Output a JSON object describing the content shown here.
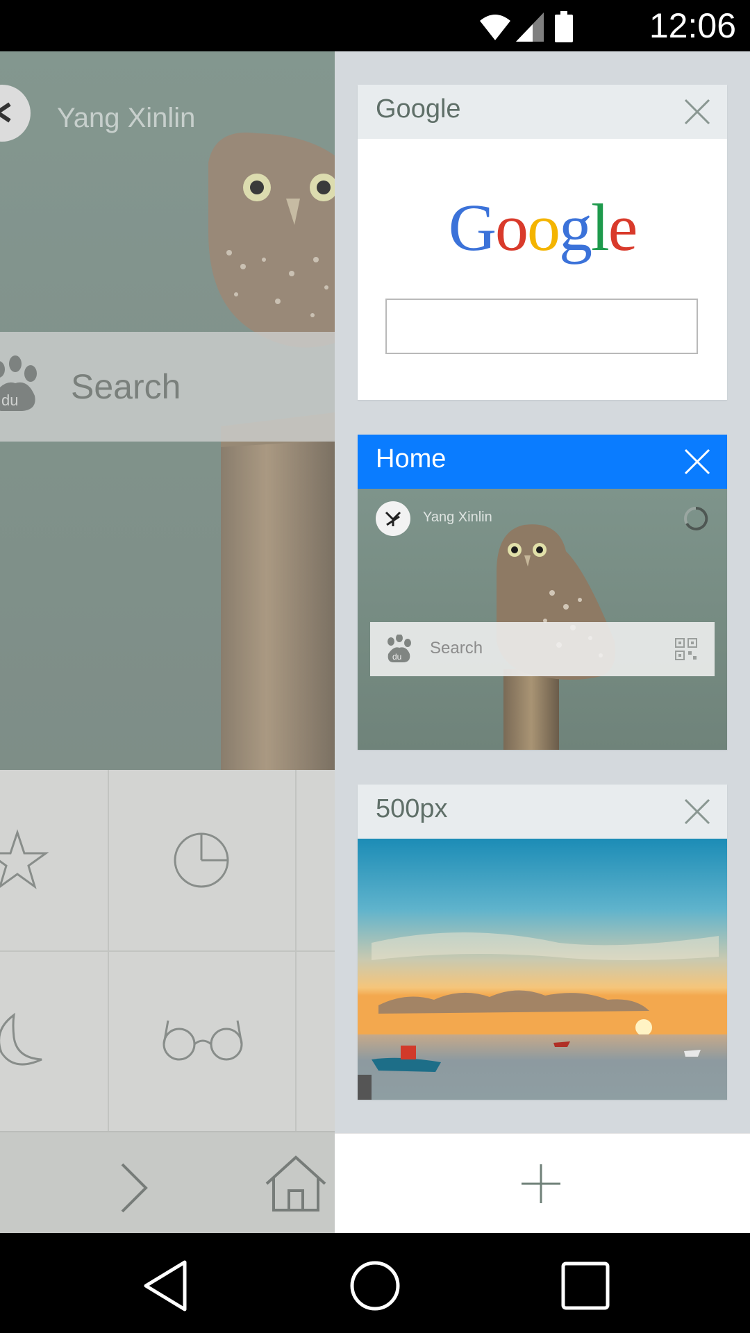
{
  "status_bar": {
    "time": "12:06",
    "icons": [
      "wifi-icon",
      "cell-signal-icon",
      "battery-icon"
    ]
  },
  "background_page": {
    "user_name": "Yang Xinlin",
    "search_placeholder": "Search",
    "grid_icons": [
      "star-icon",
      "pie-chart-icon",
      "moon-icon",
      "glasses-icon"
    ],
    "bottom_icons": [
      "forward-icon",
      "home-icon"
    ]
  },
  "tabs": [
    {
      "title": "Google",
      "active": false,
      "content": "google-homepage",
      "logo_text": "Google"
    },
    {
      "title": "Home",
      "active": true,
      "content": "home-page",
      "user_name": "Yang Xinlin",
      "search_placeholder": "Search"
    },
    {
      "title": "500px",
      "active": false,
      "content": "sunset-photo"
    }
  ],
  "colors": {
    "active_tab": "#0a7cff",
    "tab_header": "#e8ecee",
    "panel_bg": "#d4d9dd",
    "google_blue": "#3b72d9",
    "google_red": "#d93a2b",
    "google_yellow": "#f4b400",
    "google_green": "#1e9a4c"
  },
  "nav_bar": {
    "buttons": [
      "back-triangle-icon",
      "home-circle-icon",
      "recents-square-icon"
    ]
  }
}
